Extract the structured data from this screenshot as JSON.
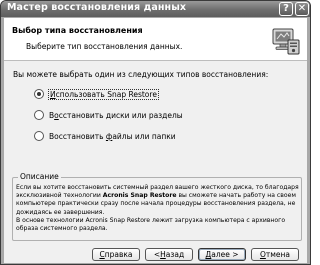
{
  "window": {
    "title": "Мастер восстановления данных",
    "help_glyph": "?",
    "close_glyph": "✕"
  },
  "header": {
    "title": "Выбор типа восстановления",
    "subtitle": "Выберите тип восстановления данных.",
    "icon": "wizard-computer-icon"
  },
  "prompt": "Вы можете выбрать один из следующих типов восстановления:",
  "options": [
    {
      "label": "Использовать Snap Restore",
      "mnemonic": "И",
      "rest": "спользовать Snap Restore",
      "checked": true
    },
    {
      "label": "Восстановить диски или разделы",
      "pre": "В",
      "mnemonic": "о",
      "rest": "сстановить диски или разделы",
      "checked": false
    },
    {
      "label": "Восстановить файлы или папки",
      "pre": "Восстановить ",
      "mnemonic": "ф",
      "rest": "айлы или папки",
      "checked": false
    }
  ],
  "description": {
    "legend": "Описание",
    "lines": [
      "Если вы хотите восстановить системный раздел вашего жесткого диска, то благодаря",
      "эксклюзивной технологии ",
      "вы сможете начать работу на своем",
      "компьютере практически сразу после начала процедуры восстановления раздела, не",
      "дожидаясь ее завершения.",
      "В основе технологии Acronis Snap Restore лежит загрузка компьютера с архивного",
      "образа системного раздела."
    ],
    "bold_term": "Acronis Snap Restore"
  },
  "buttons": {
    "help": {
      "mnemonic": "С",
      "rest": "правка"
    },
    "back": {
      "pre": "< ",
      "mnemonic": "Н",
      "rest": "азад"
    },
    "next": {
      "mnemonic": "Д",
      "rest": "алее >"
    },
    "cancel": {
      "mnemonic": "О",
      "rest": "тмена"
    }
  }
}
